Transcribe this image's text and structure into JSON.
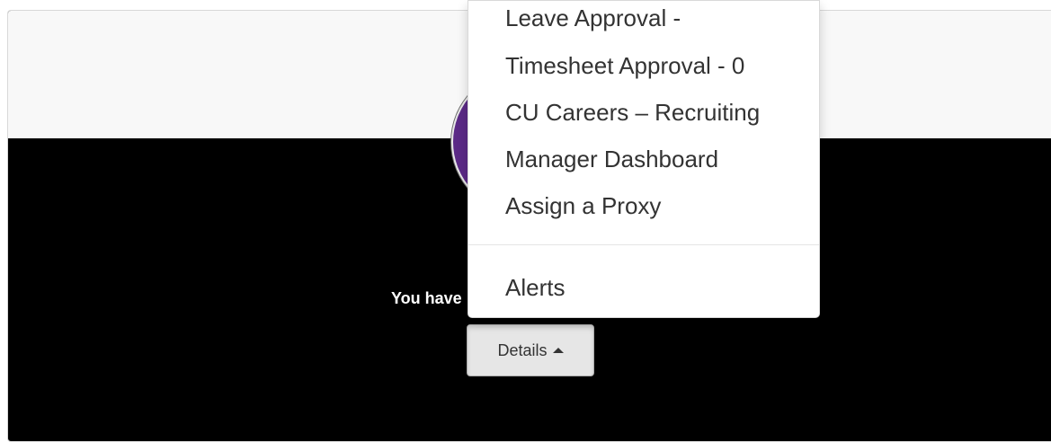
{
  "dropdown": {
    "items": [
      {
        "label": "Leave Approval -"
      },
      {
        "label": "Timesheet Approval - 0"
      },
      {
        "label": "CU Careers – Recruiting"
      },
      {
        "label": "Manager Dashboard"
      },
      {
        "label": "Assign a Proxy"
      }
    ],
    "alerts_label": "Alerts"
  },
  "card": {
    "message": "You have",
    "details_button_label": "Details"
  },
  "colors": {
    "card_background": "#000000",
    "card_top": "#f8f8f8",
    "avatar": "#5b2a86",
    "button": "#e6e6e6"
  },
  "icons": {
    "details_caret": "caret-up-icon"
  }
}
